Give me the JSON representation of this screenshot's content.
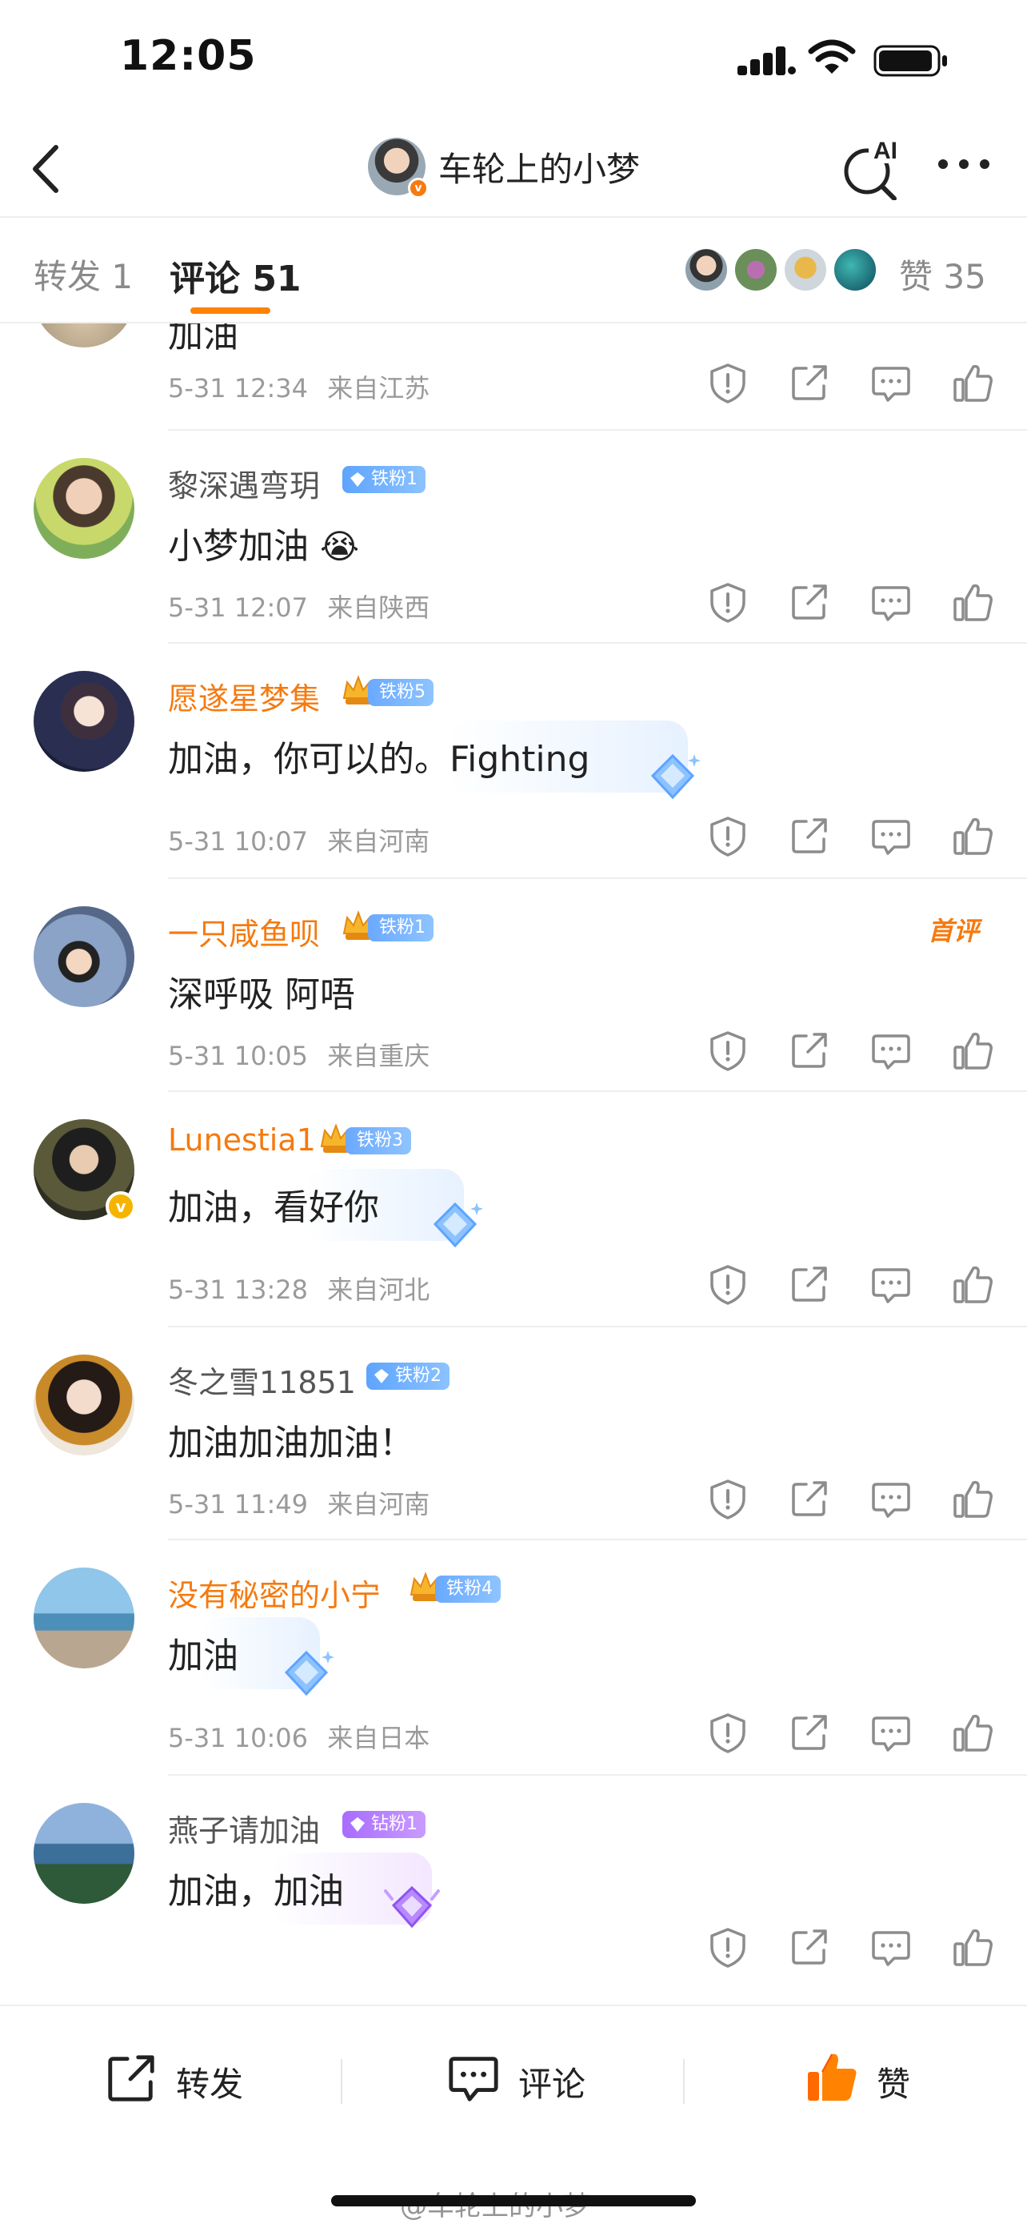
{
  "status_bar": {
    "time": "12:05"
  },
  "header": {
    "title": "车轮上的小梦",
    "ai_label": "AI"
  },
  "tabs": {
    "repost": "转发 1",
    "comments": "评论 51",
    "likes": "赞 35"
  },
  "comments": [
    {
      "username": "",
      "text": "加油",
      "time": "5-31 12:34",
      "location": "来自江苏"
    },
    {
      "username": "黎深遇弯玥",
      "fan_badge": "铁粉1",
      "text": "小梦加油",
      "emoji": "😭",
      "time": "5-31 12:07",
      "location": "来自陕西"
    },
    {
      "username": "愿遂星梦集",
      "fan_badge": "铁粉5",
      "text": "加油，你可以的。Fighting",
      "time": "5-31 10:07",
      "location": "来自河南"
    },
    {
      "username": "一只咸鱼呗",
      "fan_badge": "铁粉1",
      "text": "深呼吸 阿唔",
      "time": "5-31 10:05",
      "location": "来自重庆",
      "tag": "首评"
    },
    {
      "username": "Lunestia1",
      "fan_badge": "铁粉3",
      "text": "加油，看好你",
      "time": "5-31 13:28",
      "location": "来自河北"
    },
    {
      "username": "冬之雪11851",
      "fan_badge": "铁粉2",
      "text": "加油加油加油！",
      "time": "5-31 11:49",
      "location": "来自河南"
    },
    {
      "username": "没有秘密的小宁",
      "fan_badge": "铁粉4",
      "text": "加油",
      "time": "5-31 10:06",
      "location": "来自日本"
    },
    {
      "username": "燕子请加油",
      "fan_badge": "钻粉1",
      "text": "加油，加油",
      "time": "",
      "location": ""
    }
  ],
  "toolbar": {
    "repost": "转发",
    "comment": "评论",
    "like": "赞"
  },
  "watermark": "@车轮上的小梦",
  "colors": {
    "accent": "#ff8200",
    "vip_name": "#f57a0f",
    "meta": "#9a9a9a",
    "iron_fan": "#5ea4ff",
    "diamond_fan": "#a86cff"
  }
}
